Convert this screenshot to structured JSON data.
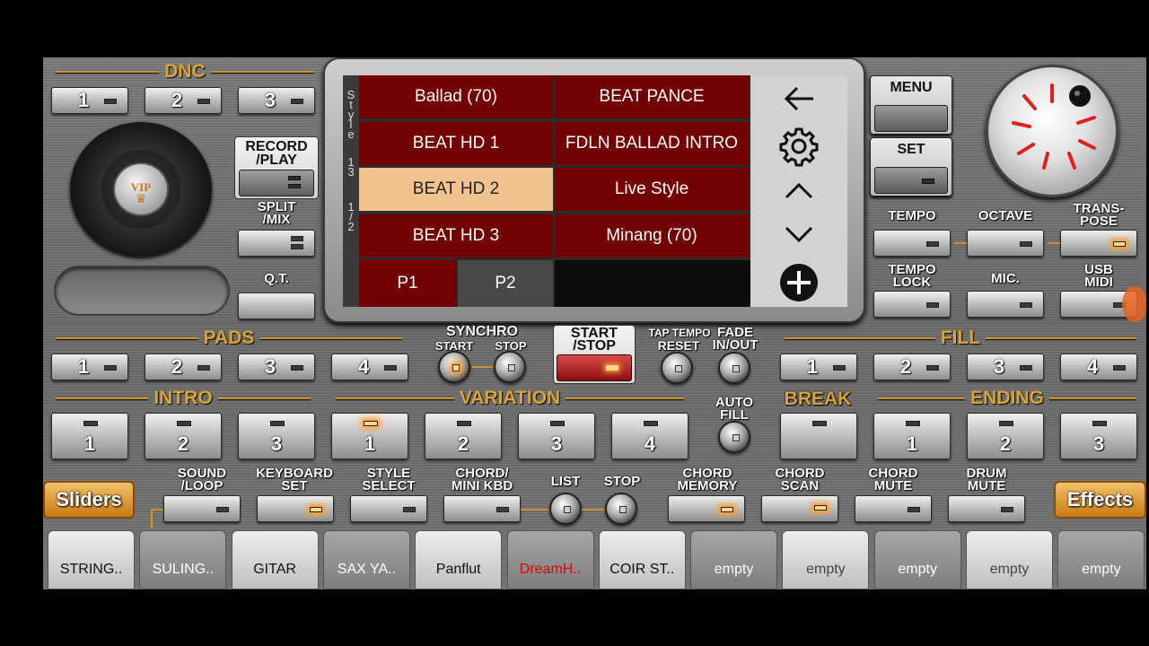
{
  "dnc": {
    "title": "DNC",
    "buttons": [
      "1",
      "2",
      "3"
    ]
  },
  "record_play": {
    "label": "RECORD\n/PLAY"
  },
  "split_mix": {
    "label": "SPLIT\n/MIX"
  },
  "qt": {
    "label": "Q.T."
  },
  "logo_text": "VIP",
  "screen": {
    "vertical_labels": {
      "style": "Style",
      "index": "13",
      "page": "1/2"
    },
    "styles": [
      {
        "label": "Ballad (70)",
        "selected": false
      },
      {
        "label": "BEAT PANCE",
        "selected": false
      },
      {
        "label": "BEAT HD 1",
        "selected": false
      },
      {
        "label": "FDLN BALLAD INTRO",
        "selected": false
      },
      {
        "label": "BEAT HD 2",
        "selected": true
      },
      {
        "label": "Live Style",
        "selected": false
      },
      {
        "label": "BEAT HD 3",
        "selected": false
      },
      {
        "label": "Minang (70)",
        "selected": false
      }
    ],
    "pages": [
      "P1",
      "P2"
    ],
    "active_page": "P1",
    "side_icons": [
      "back-arrow-icon",
      "gear-icon",
      "chevron-up-icon",
      "chevron-down-icon",
      "plus-circle-icon"
    ]
  },
  "menu": {
    "label": "MENU"
  },
  "set": {
    "label": "SET"
  },
  "controls_top": {
    "tempo": "TEMPO",
    "octave": "OCTAVE",
    "transpose": "TRANS-\nPOSE",
    "tempo_lock": "TEMPO\nLOCK",
    "mic": "MIC.",
    "usb_midi": "USB\nMIDI"
  },
  "pads": {
    "title": "PADS",
    "buttons": [
      "1",
      "2",
      "3",
      "4"
    ]
  },
  "synchro": {
    "title": "SYNCHRO",
    "start": "START",
    "stop": "STOP"
  },
  "start_stop": {
    "label": "START\n/STOP"
  },
  "tap_tempo": {
    "label": "TAP TEMPO",
    "reset": "RESET"
  },
  "fade": {
    "label": "FADE\nIN/OUT"
  },
  "fill": {
    "title": "FILL",
    "buttons": [
      "1",
      "2",
      "3",
      "4"
    ]
  },
  "intro": {
    "title": "INTRO",
    "buttons": [
      "1",
      "2",
      "3"
    ]
  },
  "variation": {
    "title": "VARIATION",
    "buttons": [
      "1",
      "2",
      "3",
      "4"
    ]
  },
  "auto_fill": {
    "label": "AUTO\nFILL"
  },
  "break": {
    "title": "BREAK"
  },
  "ending": {
    "title": "ENDING",
    "buttons": [
      "1",
      "2",
      "3"
    ]
  },
  "sliders": {
    "label": "Sliders"
  },
  "effects": {
    "label": "Effects"
  },
  "bottom_controls": {
    "sound_loop": "SOUND\n/LOOP",
    "keyboard_set": "KEYBOARD\nSET",
    "style_select": "STYLE\nSELECT",
    "chord_mini_kbd": "CHORD/\nMINI KBD",
    "list": "LIST",
    "stop": "STOP",
    "chord_memory": "CHORD\nMEMORY",
    "chord_scan": "CHORD\nSCAN",
    "chord_mute": "CHORD\nMUTE",
    "drum_mute": "DRUM\nMUTE"
  },
  "sound_pads": [
    "STRING..",
    "SULING..",
    "GITAR",
    "SAX YA..",
    "Panflut",
    "DreamH..",
    "COIR ST..",
    "empty",
    "empty",
    "empty",
    "empty",
    "empty"
  ],
  "colors": {
    "accent_gold": "#d8a33a",
    "style_cell": "#720000",
    "style_selected": "#f3c38f",
    "led_on": "#ff9e2e"
  }
}
